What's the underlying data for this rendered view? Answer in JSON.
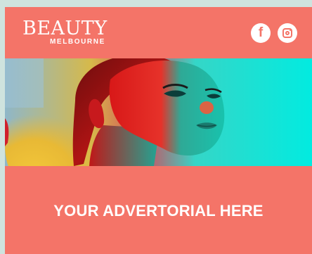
{
  "brand": {
    "name": "BEAUTY",
    "subname": "MELBOURNE"
  },
  "social": {
    "facebook_glyph": "f",
    "facebook_icon": "facebook-icon",
    "instagram_icon": "instagram-icon"
  },
  "hero": {
    "image": "portrait with neon red, teal and yellow lighting"
  },
  "banner": {
    "headline": "YOUR ADVERTORIAL HERE"
  },
  "colors": {
    "brand_coral": "#f47468",
    "page_background": "#cfe3de",
    "text": "#ffffff"
  }
}
